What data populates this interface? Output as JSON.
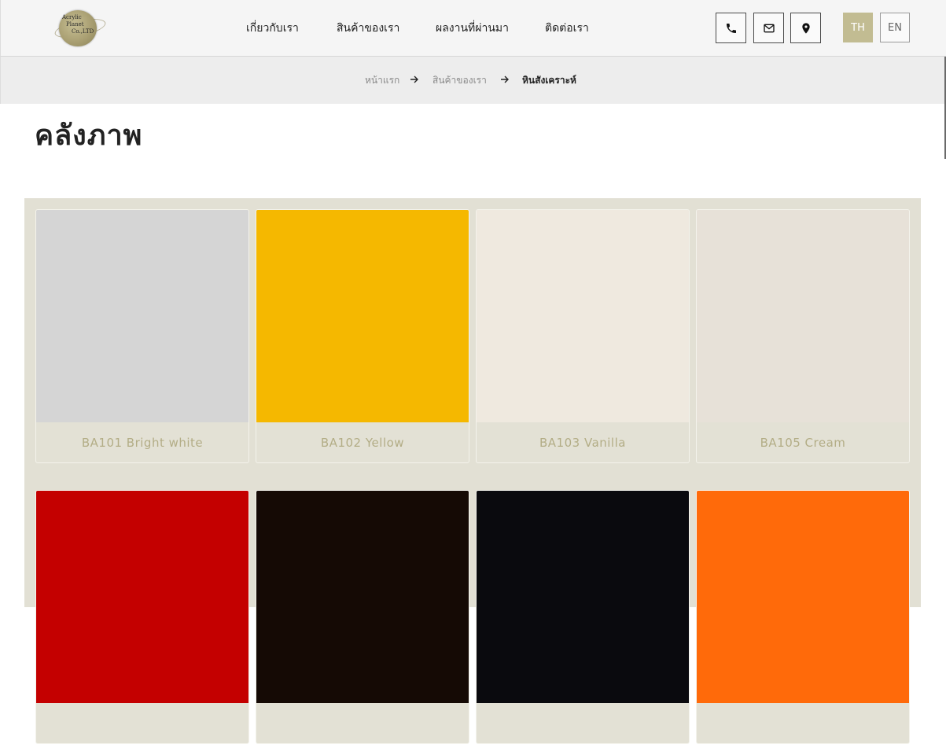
{
  "header": {
    "logo": {
      "line1": "Acrylic",
      "line2": "Planet",
      "line3": "Co.,LTD"
    },
    "nav": [
      {
        "label": "เกี่ยวกับเรา"
      },
      {
        "label": "สินค้าของเรา"
      },
      {
        "label": "ผลงานที่ผ่านมา"
      },
      {
        "label": "ติดต่อเรา"
      }
    ],
    "contact_icons": [
      "phone-icon",
      "mail-icon",
      "location-pin-icon"
    ],
    "languages": [
      {
        "label": "TH",
        "active": true
      },
      {
        "label": "EN",
        "active": false
      }
    ]
  },
  "breadcrumb": {
    "items": [
      {
        "label": "หน้าแรก"
      },
      {
        "label": "สินค้าของเรา"
      },
      {
        "label": "หินสังเคราะห์"
      }
    ],
    "separator_icon": "arrow-right-icon"
  },
  "page": {
    "title": "คลังภาพ"
  },
  "gallery": {
    "items": [
      {
        "label": "BA101 Bright white",
        "color": "#d5d5d5"
      },
      {
        "label": "BA102 Yellow",
        "color": "#f5b800"
      },
      {
        "label": "BA103 Vanilla",
        "color": "#efe9df"
      },
      {
        "label": "BA105 Cream",
        "color": "#e7e1d8"
      },
      {
        "label": "",
        "color": "#c40000"
      },
      {
        "label": "",
        "color": "#150a05"
      },
      {
        "label": "",
        "color": "#0a0a0e"
      },
      {
        "label": "",
        "color": "#ff6a0a"
      }
    ]
  },
  "colors": {
    "accent": "#c2bc92",
    "gallery_bg": "#e2e0d4",
    "label_text": "#b3ad86",
    "header_bg": "#f5f5f5",
    "breadcrumb_bg": "#ededed"
  }
}
